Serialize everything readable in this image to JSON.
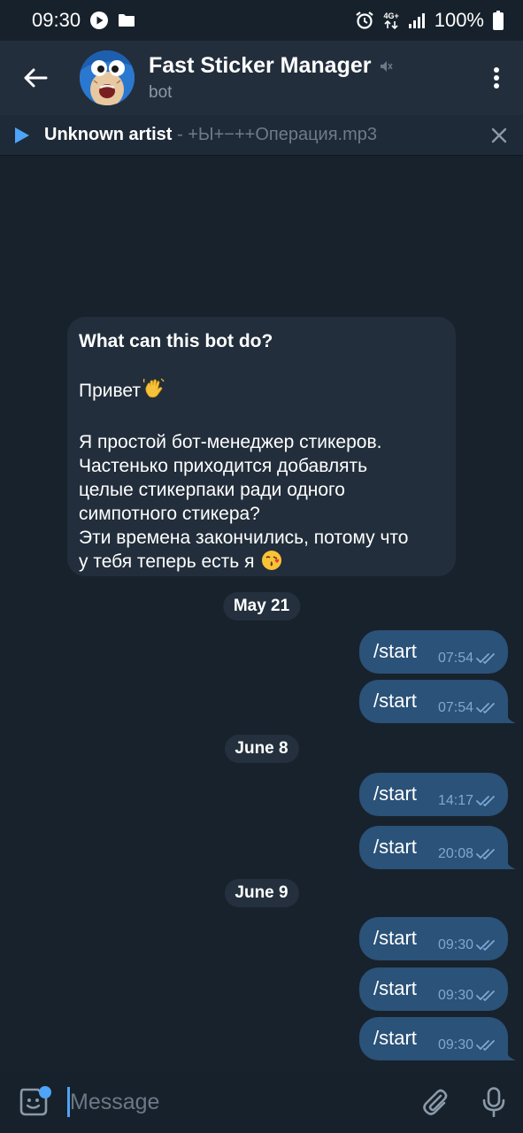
{
  "status_bar": {
    "time": "09:30",
    "network": "4G+",
    "battery": "100%"
  },
  "header": {
    "title": "Fast Sticker Manager",
    "subtitle": "bot"
  },
  "player": {
    "artist": "Unknown artist",
    "separator": " - ",
    "track": "+Ы+−++Операция.mp3"
  },
  "intro": {
    "title": "What can this bot do?",
    "greeting": "Привет",
    "greeting_emoji": "waving-hand",
    "lines": [
      "Я простой бот-менеджер стикеров.",
      "Частенько приходится добавлять",
      "целые стикерпаки ради одного",
      "симпотного стикера?",
      "Эти времена закончились, потому что"
    ],
    "last_line": "у тебя теперь есть я",
    "last_emoji": "face-blowing-kiss"
  },
  "dates": [
    "May 21",
    "June 8",
    "June 9"
  ],
  "messages": [
    {
      "text": "/start",
      "time": "07:54"
    },
    {
      "text": "/start",
      "time": "07:54"
    },
    {
      "text": "/start",
      "time": "14:17"
    },
    {
      "text": "/start",
      "time": "20:08"
    },
    {
      "text": "/start",
      "time": "09:30"
    },
    {
      "text": "/start",
      "time": "09:30"
    },
    {
      "text": "/start",
      "time": "09:30"
    }
  ],
  "input": {
    "placeholder": "Message"
  },
  "colors": {
    "background": "#18222d",
    "header": "#232e3c",
    "outgoing_bubble": "#2b5278",
    "incoming_card": "#222e3b",
    "accent": "#4ea4f6",
    "read_check": "#7da8d3"
  }
}
